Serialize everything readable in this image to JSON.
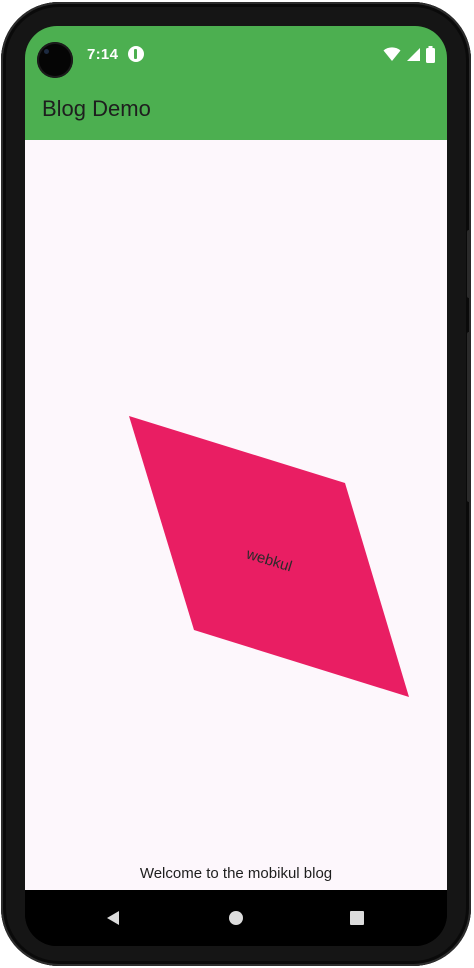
{
  "status_bar": {
    "time": "7:14",
    "icons": [
      "camera-cutout",
      "notification-icon",
      "wifi-icon",
      "signal-icon",
      "battery-icon"
    ]
  },
  "app_bar": {
    "title": "Blog Demo",
    "color": "#4caf50"
  },
  "content": {
    "shape_label": "webkul",
    "shape_color": "#e91e63",
    "background": "#fdf7fc",
    "welcome_text": "Welcome to the mobikul blog"
  },
  "nav_bar": {
    "buttons": [
      "back-icon",
      "home-icon",
      "recents-icon"
    ]
  }
}
